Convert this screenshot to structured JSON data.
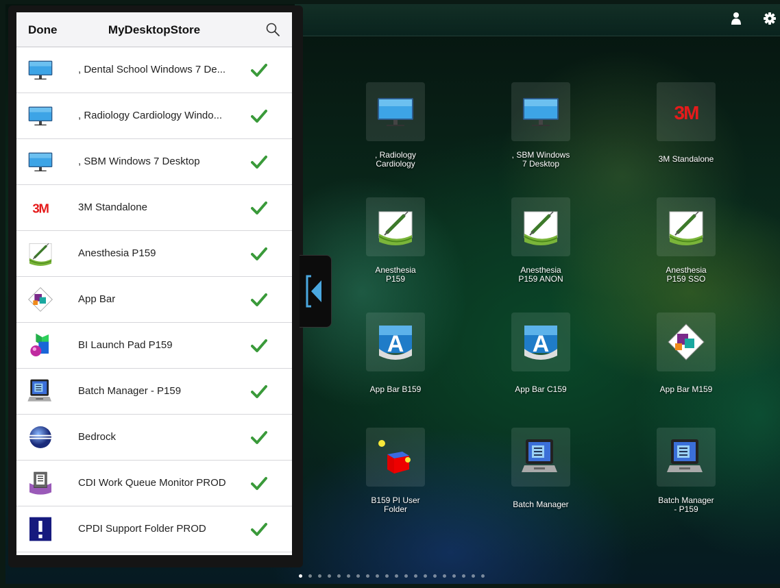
{
  "panel": {
    "done_label": "Done",
    "title": "MyDesktopStore",
    "items": [
      {
        "label": ", Dental School Windows 7 De...",
        "icon": "monitor-icon"
      },
      {
        "label": ", Radiology Cardiology Windo...",
        "icon": "monitor-icon"
      },
      {
        "label": ", SBM Windows 7 Desktop",
        "icon": "monitor-icon"
      },
      {
        "label": "3M Standalone",
        "icon": "3m-logo-icon"
      },
      {
        "label": "Anesthesia P159",
        "icon": "syringe-icon"
      },
      {
        "label": "App Bar",
        "icon": "appbar-diamond-icon"
      },
      {
        "label": "BI Launch Pad P159",
        "icon": "bi-launchpad-icon"
      },
      {
        "label": "Batch Manager - P159",
        "icon": "computer-terminal-icon"
      },
      {
        "label": "Bedrock",
        "icon": "eclipse-sphere-icon"
      },
      {
        "label": "CDI Work Queue Monitor PROD",
        "icon": "document-clipboard-icon"
      },
      {
        "label": "CPDI Support Folder PROD",
        "icon": "exclamation-icon"
      }
    ]
  },
  "tiles": [
    {
      "name": ", Radiology\nCardiology",
      "icon": "monitor-icon"
    },
    {
      "name": ", SBM Windows\n7 Desktop",
      "icon": "monitor-icon"
    },
    {
      "name": "3M Standalone",
      "icon": "3m-logo-icon"
    },
    {
      "name": "Anesthesia\nP159",
      "icon": "syringe-icon"
    },
    {
      "name": "Anesthesia\nP159 ANON",
      "icon": "syringe-icon"
    },
    {
      "name": "Anesthesia\nP159 SSO",
      "icon": "syringe-icon"
    },
    {
      "name": "App Bar B159",
      "icon": "app-a-icon"
    },
    {
      "name": "App Bar C159",
      "icon": "app-a-icon"
    },
    {
      "name": "App Bar M159",
      "icon": "appbar-diamond-icon"
    },
    {
      "name": "B159 PI User\nFolder",
      "icon": "cube-folder-icon"
    },
    {
      "name": "Batch Manager",
      "icon": "computer-terminal-icon"
    },
    {
      "name": "Batch Manager\n- P159",
      "icon": "computer-terminal-icon"
    }
  ],
  "page_indicator": {
    "total": 20,
    "current": 1
  },
  "colors": {
    "check": "#3a9a3a",
    "accent": "#4aa8e0",
    "threem_red": "#e51b1b"
  }
}
